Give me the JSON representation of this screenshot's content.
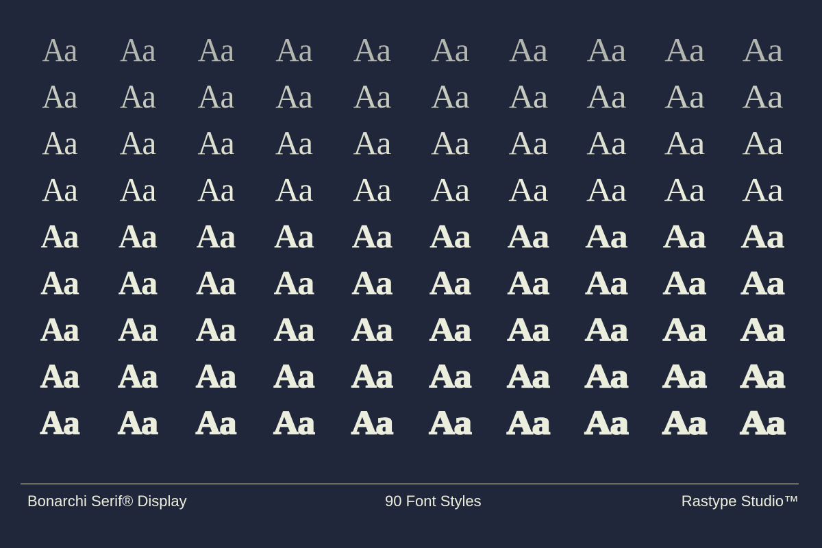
{
  "specimen": {
    "glyphs": "Aa",
    "rows": 9,
    "columns": 10,
    "color": "#eceedd",
    "background": "#21273a"
  },
  "footer": {
    "font_name": "Bonarchi Serif® Display",
    "style_count": "90 Font Styles",
    "studio": "Rastype Studio™"
  }
}
